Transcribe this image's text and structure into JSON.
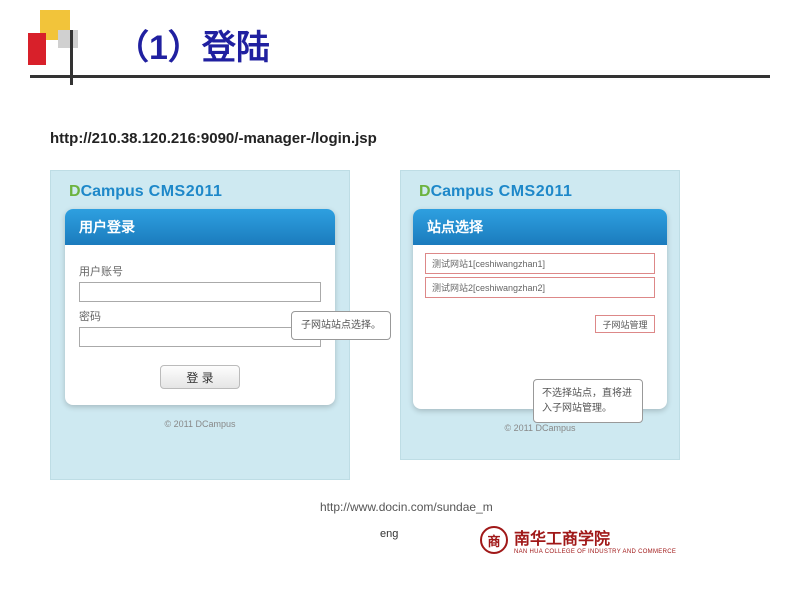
{
  "slide": {
    "title": "（1）登陆",
    "url": "http://210.38.120.216:9090/-manager-/login.jsp"
  },
  "brand": {
    "d": "D",
    "campus": "Campus",
    "cms": " CMS2011"
  },
  "login": {
    "header": "用户登录",
    "username_label": "用户账号",
    "password_label": "密码",
    "button": "登 录",
    "copyright": "© 2011 DCampus"
  },
  "siteselect": {
    "header": "站点选择",
    "items": [
      "测试网站1[ceshiwangzhan1]",
      "测试网站2[ceshiwangzhan2]"
    ],
    "sub_button": "子网站管理",
    "callout1": "子网站站点选择。",
    "callout2": "不选择站点，直将进入子网站管理。",
    "copyright": "© 2011 DCampus"
  },
  "footer": {
    "docin": "http://www.docin.com/sundae_m",
    "eng": "eng",
    "logo_text": "南华工商学院",
    "logo_sub": "NAN HUA COLLEGE OF INDUSTRY AND COMMERCE",
    "seal_char": "商"
  }
}
